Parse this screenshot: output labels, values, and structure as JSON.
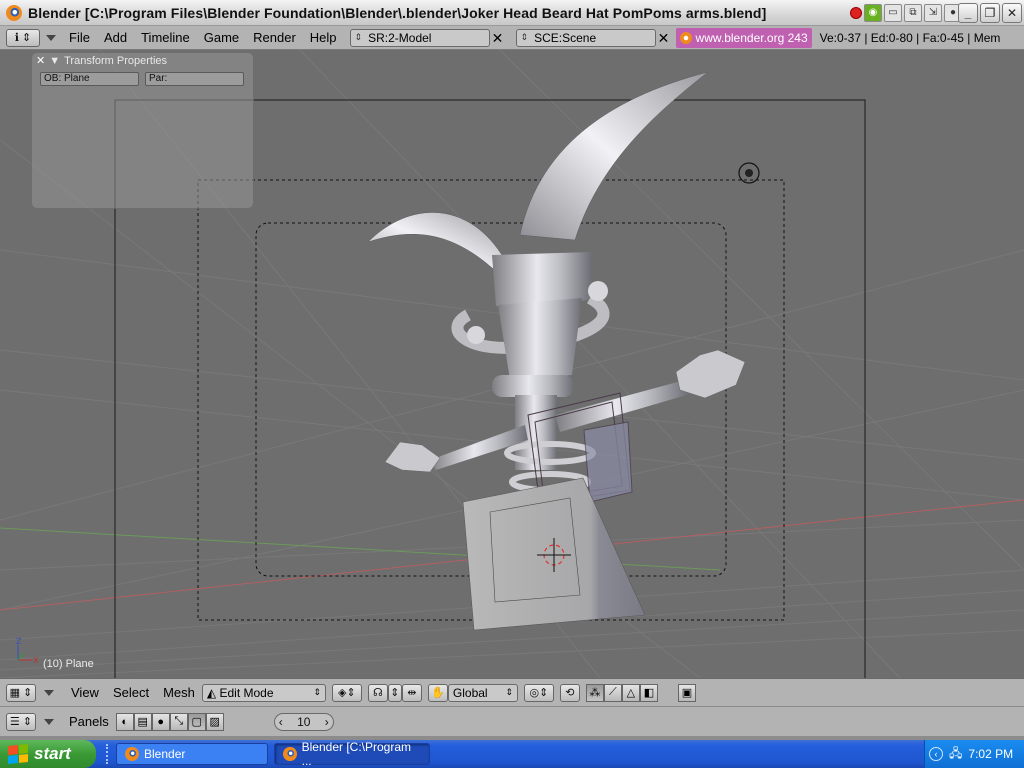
{
  "window": {
    "title": "Blender [C:\\Program Files\\Blender Foundation\\Blender\\.blender\\Joker Head Beard Hat  PomPoms arms.blend]"
  },
  "top_header": {
    "menus": [
      "File",
      "Add",
      "Timeline",
      "Game",
      "Render",
      "Help"
    ],
    "screen_field": "SR:2-Model",
    "scene_field": "SCE:Scene",
    "website": "www.blender.org 243",
    "stats": "Ve:0-37 | Ed:0-80 | Fa:0-45 | Mem"
  },
  "transform_panel": {
    "title": "Transform Properties",
    "ob_field": "OB: Plane",
    "par_field": "Par:"
  },
  "viewport": {
    "object_label": "(10) Plane",
    "axis_x": "X",
    "axis_z": "Z"
  },
  "view_header": {
    "menus": [
      "View",
      "Select",
      "Mesh"
    ],
    "mode": "Edit Mode",
    "orientation": "Global"
  },
  "buttons_header": {
    "panels_label": "Panels",
    "frame_value": "10"
  },
  "taskbar": {
    "start_label": "start",
    "tasks": [
      "Blender",
      "Blender [C:\\Program ..."
    ],
    "clock": "7:02 PM"
  },
  "colors": {
    "viewport_bg": "#6e6e6e",
    "header_bg": "#b3b3b3",
    "website_badge": "#c060b0",
    "taskbar_blue": "#245edb",
    "start_green": "#3a9a35"
  }
}
